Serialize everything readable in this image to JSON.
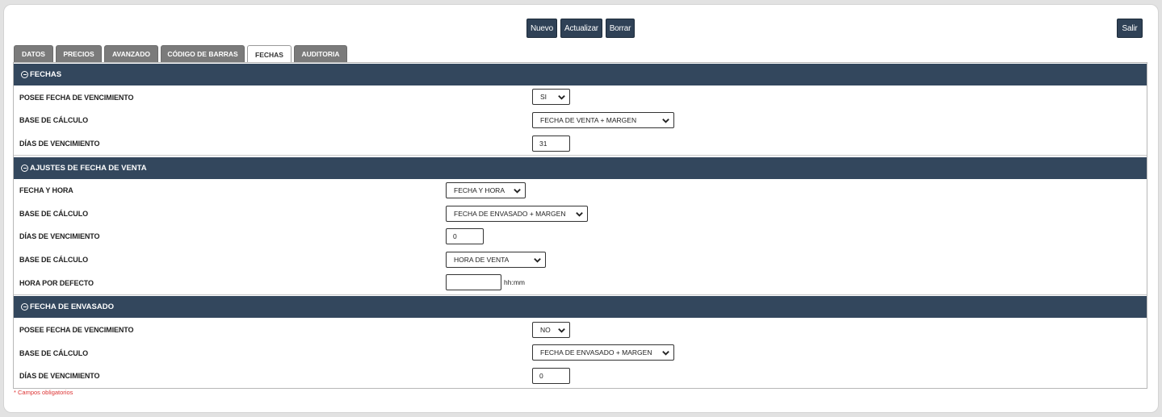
{
  "toolbar": {
    "new_label": "Nuevo",
    "update_label": "Actualizar",
    "delete_label": "Borrar",
    "exit_label": "Salir"
  },
  "tabs": [
    {
      "label": "DATOS"
    },
    {
      "label": "PRECIOS"
    },
    {
      "label": "AVANZADO"
    },
    {
      "label": "CÓDIGO DE BARRAS"
    },
    {
      "label": "FECHAS",
      "active": true
    },
    {
      "label": "AUDITORIA"
    }
  ],
  "sections": {
    "fechas": {
      "title": "FECHAS",
      "rows": [
        {
          "label": "POSEE FECHA DE VENCIMIENTO",
          "value": "SI"
        },
        {
          "label": "BASE DE CÁLCULO",
          "value": "FECHA DE VENTA + MARGEN"
        },
        {
          "label": "DÍAS DE VENCIMIENTO",
          "value": "31"
        }
      ]
    },
    "ajustes": {
      "title": "AJUSTES DE FECHA DE VENTA",
      "rows": [
        {
          "label": "FECHA Y HORA",
          "value": "FECHA Y HORA"
        },
        {
          "label": "BASE DE CÁLCULO",
          "value": "FECHA DE ENVASADO + MARGEN"
        },
        {
          "label": "DÍAS DE VENCIMIENTO",
          "value": "0"
        },
        {
          "label": "BASE DE CÁLCULO",
          "value": "HORA DE VENTA"
        },
        {
          "label": "HORA POR DEFECTO",
          "value": "",
          "hint": "hh:mm"
        }
      ]
    },
    "envasado": {
      "title": "FECHA DE ENVASADO",
      "rows": [
        {
          "label": "POSEE FECHA DE VENCIMIENTO",
          "value": "NO"
        },
        {
          "label": "BASE DE CÁLCULO",
          "value": "FECHA DE ENVASADO + MARGEN"
        },
        {
          "label": "DÍAS DE VENCIMIENTO",
          "value": "0"
        }
      ]
    }
  },
  "footer": {
    "required_note": "* Campos obligatorios"
  },
  "colors": {
    "header": "#33475d",
    "button": "#2f4156",
    "tab_inactive": "#7b7b7b",
    "required": "#dd3333"
  }
}
